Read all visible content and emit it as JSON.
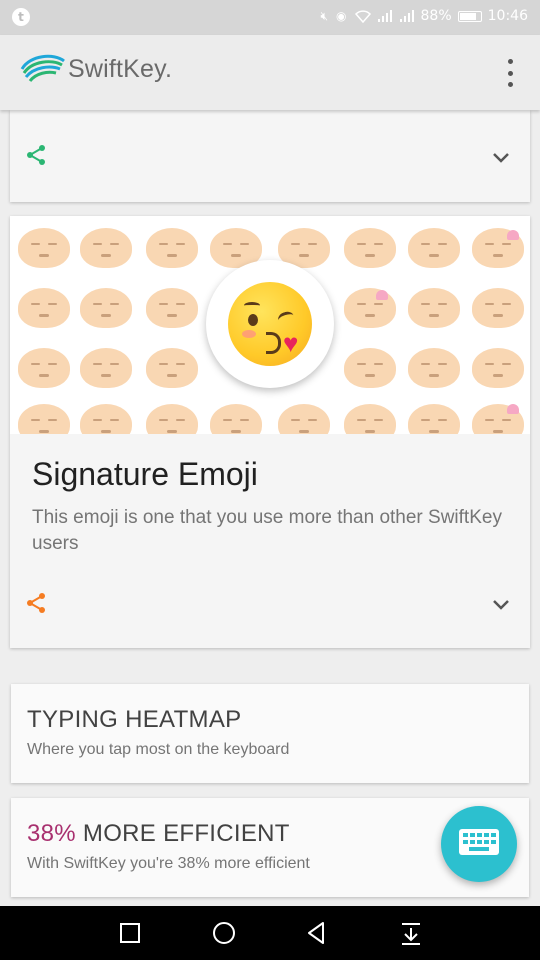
{
  "status_bar": {
    "left_icon": "t",
    "battery_pct": "88%",
    "time": "10:46",
    "icons": [
      "mute-icon",
      "eye-icon",
      "wifi-icon",
      "signal-icon",
      "signal-icon",
      "battery-icon"
    ]
  },
  "app_bar": {
    "logo_text": "SwiftKey.",
    "overflow_icon": "more-vert-icon"
  },
  "cards": {
    "top": {
      "share_icon": "share-icon",
      "expand_icon": "chevron-down-icon",
      "share_color": "#2bb673"
    },
    "signature": {
      "title": "Signature Emoji",
      "description": "This emoji is one that you use more than other SwiftKey users",
      "share_color": "#f57c22",
      "expand_icon": "chevron-down-icon"
    },
    "heatmap": {
      "title": "TYPING HEATMAP",
      "subtitle": "Where you tap most on the keyboard"
    },
    "efficiency": {
      "percent": "38%",
      "title_rest": " MORE EFFICIENT",
      "subtitle": "With SwiftKey you're 38% more efficient"
    }
  },
  "fab": {
    "icon": "keyboard-icon",
    "color": "#2cc0cf"
  },
  "nav_bar": {
    "items": [
      "recent-apps-icon",
      "home-icon",
      "back-icon",
      "notification-pull-icon"
    ]
  }
}
